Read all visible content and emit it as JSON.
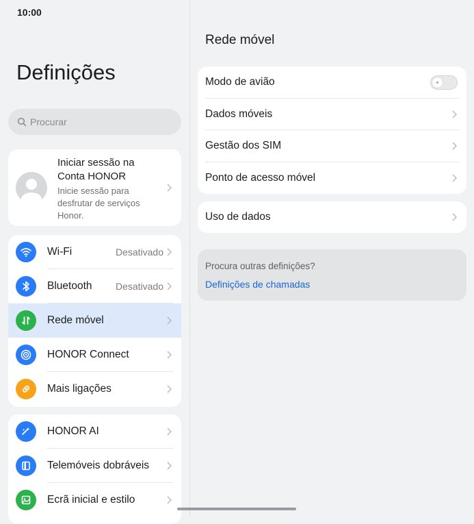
{
  "status_bar": {
    "time": "10:00"
  },
  "left": {
    "title": "Definições",
    "search": {
      "placeholder": "Procurar"
    },
    "account": {
      "title": "Iniciar sessão na Conta HONOR",
      "subtitle": "Inicie sessão para desfrutar de serviços Honor."
    },
    "connectivity": [
      {
        "label": "Wi-Fi",
        "value": "Desativado",
        "icon": "wifi-icon",
        "color": "#2a7cf6"
      },
      {
        "label": "Bluetooth",
        "value": "Desativado",
        "icon": "bluetooth-icon",
        "color": "#2a7cf6"
      },
      {
        "label": "Rede móvel",
        "value": "",
        "icon": "mobile-data-icon",
        "color": "#2bb24c",
        "selected": true
      },
      {
        "label": "HONOR Connect",
        "value": "",
        "icon": "honor-connect-icon",
        "color": "#2a7cf6"
      },
      {
        "label": "Mais ligações",
        "value": "",
        "icon": "link-icon",
        "color": "#f7a21b"
      }
    ],
    "apps": [
      {
        "label": "HONOR AI",
        "icon": "honor-ai-icon",
        "color": "#2a7cf6"
      },
      {
        "label": "Telemóveis dobráveis",
        "icon": "foldable-phone-icon",
        "color": "#2a7cf6"
      },
      {
        "label": "Ecrã inicial e estilo",
        "icon": "home-screen-icon",
        "color": "#2bb24c"
      }
    ]
  },
  "right": {
    "title": "Rede móvel",
    "group1": [
      {
        "label": "Modo de avião",
        "type": "toggle",
        "on": false
      },
      {
        "label": "Dados móveis",
        "type": "chevron"
      },
      {
        "label": "Gestão dos SIM",
        "type": "chevron"
      },
      {
        "label": "Ponto de acesso móvel",
        "type": "chevron"
      }
    ],
    "group2": [
      {
        "label": "Uso de dados",
        "type": "chevron"
      }
    ],
    "suggest": {
      "question": "Procura outras definições?",
      "link": "Definições de chamadas"
    }
  },
  "colors": {
    "accent": "#1967d2",
    "selected_row": "#dde8fb"
  }
}
